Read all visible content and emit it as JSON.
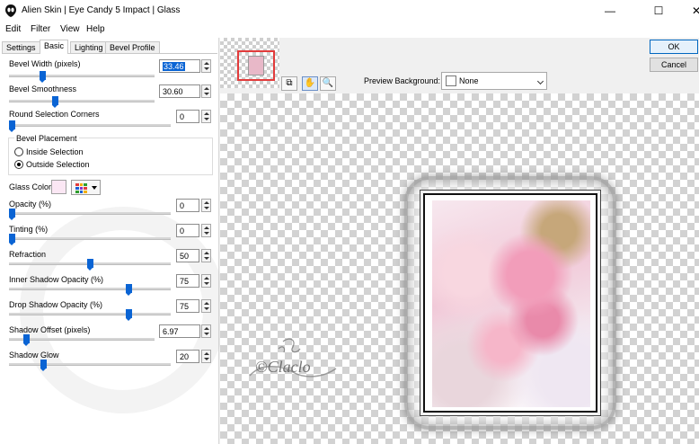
{
  "window": {
    "title": "Alien Skin | Eye Candy 5 Impact | Glass",
    "minimize": "—",
    "maximize": "☐",
    "close": "✕"
  },
  "menu": [
    "Edit",
    "Filter",
    "View",
    "Help"
  ],
  "tabs": [
    "Settings",
    "Basic",
    "Lighting",
    "Bevel Profile"
  ],
  "active_tab": "Basic",
  "controls": {
    "bevel_width": {
      "label": "Bevel Width (pixels)",
      "value": "33.46",
      "level": 0.22
    },
    "bevel_smoothness": {
      "label": "Bevel Smoothness",
      "value": "30.60",
      "level": 0.31
    },
    "round_corners": {
      "label": "Round Selection Corners",
      "value": "0",
      "level": 0.0
    },
    "bevel_placement": {
      "title": "Bevel Placement",
      "options": [
        "Inside Selection",
        "Outside Selection"
      ],
      "selected": "Outside Selection"
    },
    "glass_color": {
      "label": "Glass Color",
      "swatch": "#fbe7f4"
    },
    "opacity": {
      "label": "Opacity (%)",
      "value": "0",
      "level": 0.0
    },
    "tinting": {
      "label": "Tinting (%)",
      "value": "0",
      "level": 0.0
    },
    "refraction": {
      "label": "Refraction",
      "value": "50",
      "level": 0.5
    },
    "inner_shadow_opacity": {
      "label": "Inner Shadow Opacity (%)",
      "value": "75",
      "level": 0.75
    },
    "drop_shadow_opacity": {
      "label": "Drop Shadow Opacity (%)",
      "value": "75",
      "level": 0.75
    },
    "shadow_offset": {
      "label": "Shadow Offset (pixels)",
      "value": "6.97",
      "level": 0.1
    },
    "shadow_glow": {
      "label": "Shadow Glow",
      "value": "20",
      "level": 0.2
    }
  },
  "buttons": {
    "ok": "OK",
    "cancel": "Cancel"
  },
  "toolbar": {
    "tools": [
      "compare-icon",
      "hand-icon",
      "zoom-icon"
    ],
    "preview_background_label": "Preview Background:",
    "preview_background_value": "None"
  },
  "watermark": "©Claclo",
  "colors": {
    "accent": "#0a64d4",
    "selection_highlight": "#0a64d4",
    "navigator_frame": "#e23b3b"
  }
}
